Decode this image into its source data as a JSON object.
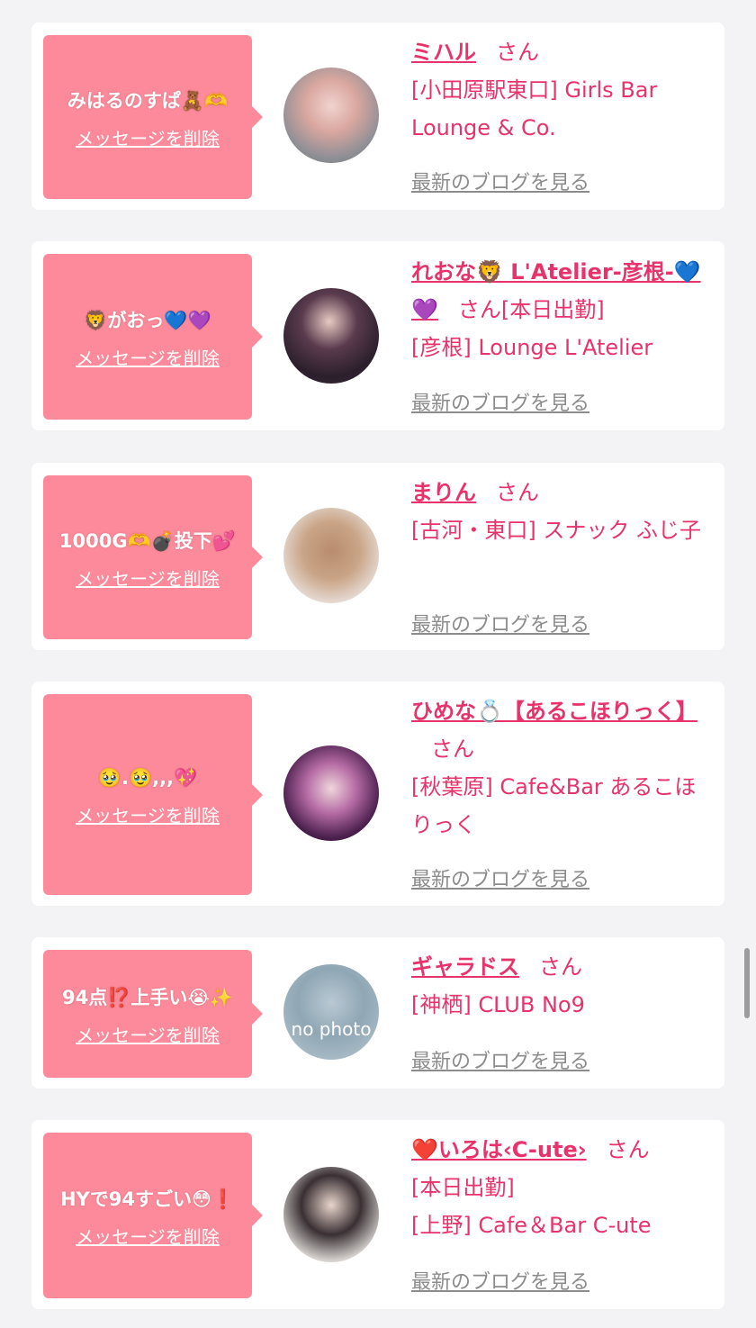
{
  "accent_color": "#e8336a",
  "bubble_color": "#fd8a9a",
  "entries": [
    {
      "message": "みはるのすぱ🧸🫶",
      "delete_label": "メッセージを削除",
      "name": "ミハル",
      "honorific": "さん",
      "status": "",
      "shop": "[小田原駅東口] Girls Bar Lounge & Co.",
      "blog_label": "最新のブログを見る"
    },
    {
      "message": "🦁がおっ💙💜",
      "delete_label": "メッセージを削除",
      "name": "れおな🦁 L'Atelier-彦根-💙💜",
      "honorific": "さん",
      "status": "[本日出勤]",
      "shop": "[彦根] Lounge L'Atelier",
      "blog_label": "最新のブログを見る"
    },
    {
      "message": "1000G🫶💣投下💕",
      "delete_label": "メッセージを削除",
      "name": "まりん",
      "honorific": "さん",
      "status": "",
      "shop": "[古河・東口] スナック ふじ子",
      "blog_label": "最新のブログを見る"
    },
    {
      "message": "🥹.🥹,,,💖",
      "delete_label": "メッセージを削除",
      "name": "ひめな💍【あるこほりっく】",
      "honorific": "さん",
      "status": "",
      "shop": "[秋葉原] Cafe&Bar あるこほりっく",
      "blog_label": "最新のブログを見る"
    },
    {
      "message": "94点⁉️上手い😭✨",
      "delete_label": "メッセージを削除",
      "name": "ギャラドス",
      "honorific": "さん",
      "status": "",
      "shop": "[神栖] CLUB No9",
      "blog_label": "最新のブログを見る",
      "avatar_text": "no photo"
    },
    {
      "message": "HYで94すごい😳❗️",
      "delete_label": "メッセージを削除",
      "name": "❤️いろは‹C-ute›",
      "honorific": "さん",
      "status": "[本日出勤]",
      "shop": "[上野] Cafe＆Bar C-ute",
      "blog_label": "最新のブログを見る"
    }
  ]
}
